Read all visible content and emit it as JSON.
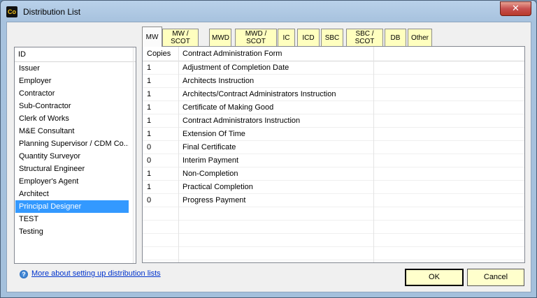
{
  "window": {
    "title": "Distribution List",
    "app_icon": "Co",
    "close_glyph": "✕"
  },
  "tabs": [
    {
      "label": "MW",
      "active": true
    },
    {
      "label": "MW / SCOT",
      "active": false
    },
    {
      "label": "MWD",
      "active": false
    },
    {
      "label": "MWD / SCOT",
      "active": false
    },
    {
      "label": "IC",
      "active": false
    },
    {
      "label": "ICD",
      "active": false
    },
    {
      "label": "SBC",
      "active": false
    },
    {
      "label": "SBC / SCOT",
      "active": false
    },
    {
      "label": "DB",
      "active": false
    },
    {
      "label": "Other",
      "active": false
    }
  ],
  "id_list": {
    "header": "ID",
    "selected": "Principal Designer",
    "items": [
      "Issuer",
      "Employer",
      "Contractor",
      "Sub-Contractor",
      "Clerk of Works",
      "M&E Consultant",
      "Planning Supervisor / CDM Co...",
      "Quantity Surveyor",
      "Structural Engineer",
      "Employer's Agent",
      "Architect",
      "Principal Designer",
      "TEST",
      "Testing"
    ]
  },
  "grid": {
    "headers": {
      "copies": "Copies",
      "form": "Contract Administration Form"
    },
    "rows": [
      {
        "copies": "1",
        "form": "Adjustment of Completion Date"
      },
      {
        "copies": "1",
        "form": "Architects Instruction"
      },
      {
        "copies": "1",
        "form": "Architects/Contract Administrators Instruction"
      },
      {
        "copies": "1",
        "form": "Certificate of Making Good"
      },
      {
        "copies": "1",
        "form": "Contract Administrators Instruction"
      },
      {
        "copies": "1",
        "form": "Extension Of Time"
      },
      {
        "copies": "0",
        "form": "Final Certificate"
      },
      {
        "copies": "0",
        "form": "Interim Payment"
      },
      {
        "copies": "1",
        "form": "Non-Completion"
      },
      {
        "copies": "1",
        "form": "Practical Completion"
      },
      {
        "copies": "0",
        "form": "Progress Payment"
      }
    ]
  },
  "footer": {
    "help_link": "More about setting up distribution lists",
    "ok_label": "OK",
    "cancel_label": "Cancel"
  },
  "colors": {
    "tab_bg": "#ffffbf",
    "button_bg": "#ffffcc",
    "selection": "#3399ff",
    "link": "#0033cc"
  }
}
